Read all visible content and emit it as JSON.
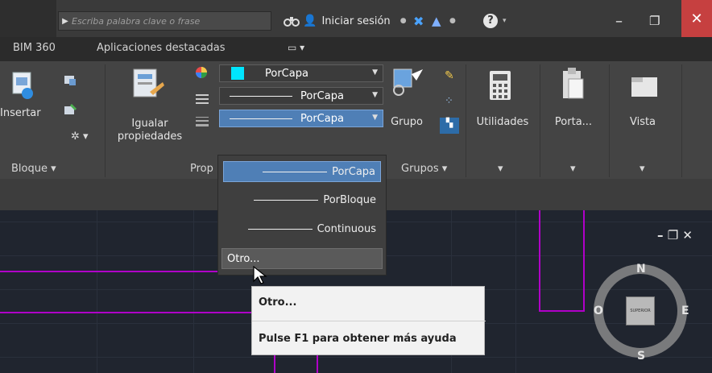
{
  "titlebar": {
    "search_placeholder": "Escriba palabra clave o frase",
    "signin_label": "Iniciar sesión",
    "help_label": "?",
    "minimize": "–",
    "restore": "❐",
    "close": "✕"
  },
  "tabs": [
    "BIM 360",
    "Aplicaciones destacadas"
  ],
  "ribbon": {
    "insert_label": "Insertar",
    "block_panel": "Bloque",
    "match_label_1": "Igualar",
    "match_label_2": "propiedades",
    "props_panel": "Prop",
    "color_value": "PorCapa",
    "linetype_value": "PorCapa",
    "lineweight_value": "PorCapa",
    "group_label": "Grupo",
    "groups_panel": "Grupos",
    "utilities_label": "Utilidades",
    "clipboard_label": "Porta...",
    "view_label": "Vista"
  },
  "dropdown": {
    "items": [
      "PorCapa",
      "PorBloque",
      "Continuous"
    ],
    "other": "Otro..."
  },
  "tooltip": {
    "title": "Otro...",
    "help": "Pulse F1 para obtener más ayuda"
  },
  "viewport": {
    "controls": "– ❐ ✕"
  },
  "viewcube": {
    "north": "N",
    "south": "S",
    "east": "E",
    "west": "O",
    "face": "SUPERIOR"
  },
  "colors": {
    "accent_selection": "#4f7fb6",
    "layer_color": "#00e5ff",
    "drawing_lines": "#b000c8"
  }
}
